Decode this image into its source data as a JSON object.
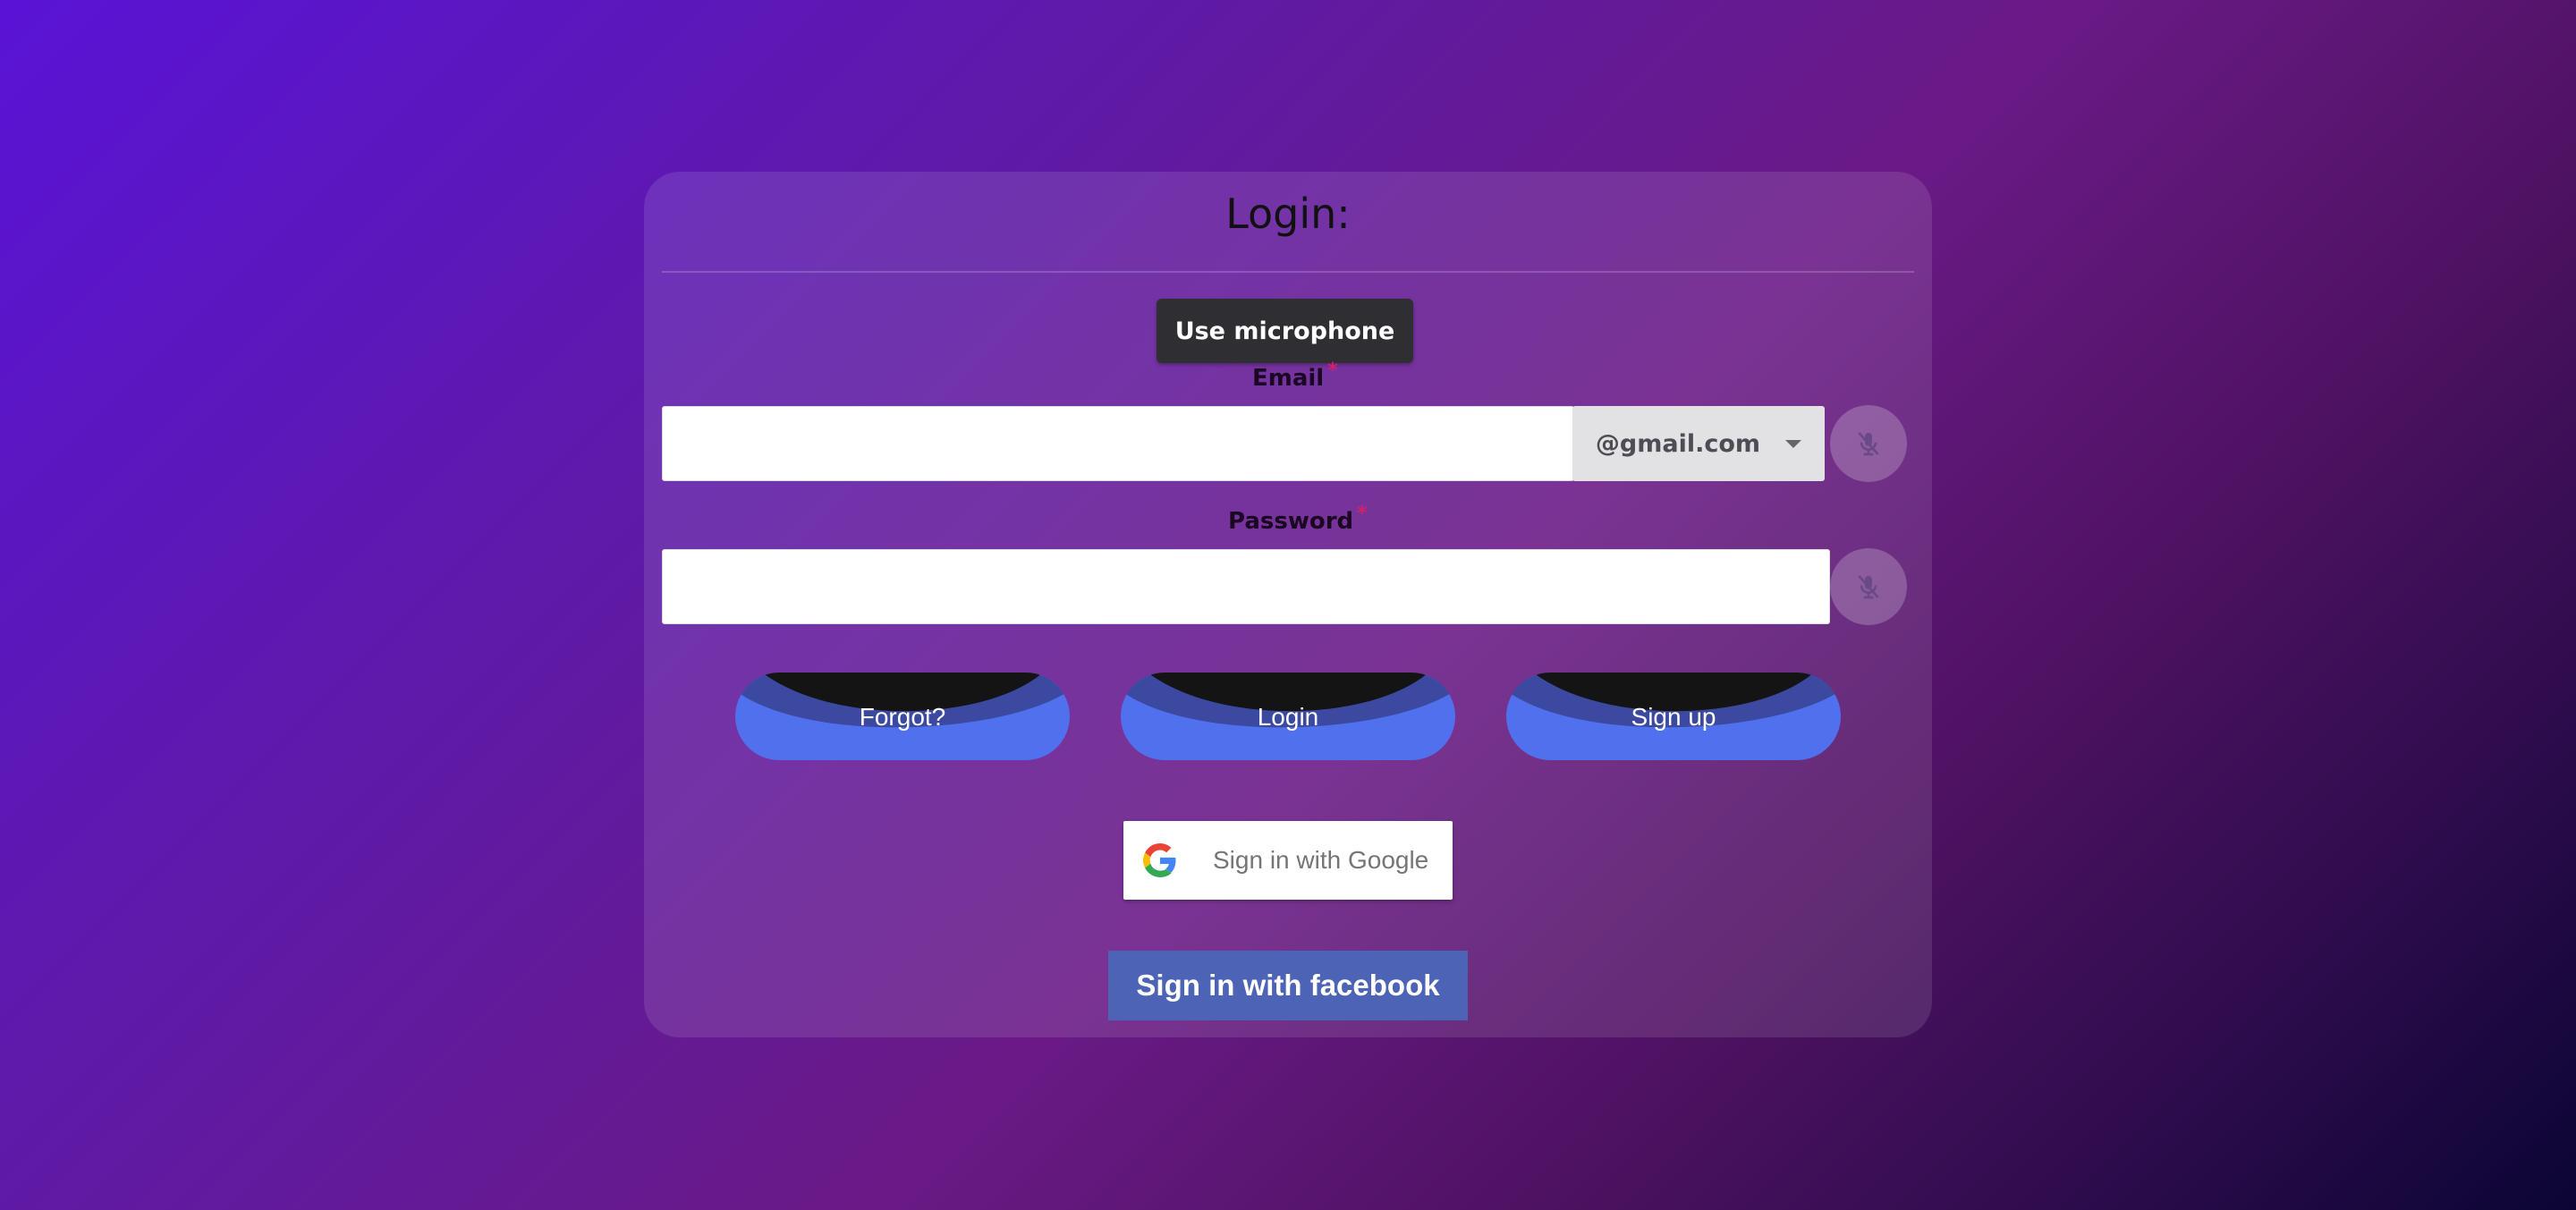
{
  "card": {
    "title": "Login:"
  },
  "microphone_button": {
    "label": "Use microphone"
  },
  "email": {
    "label": "Email",
    "required_mark": "*",
    "value": "",
    "domain_selected": "@gmail.com"
  },
  "password": {
    "label": "Password",
    "required_mark": "*",
    "value": ""
  },
  "actions": {
    "forgot": "Forgot?",
    "login": "Login",
    "signup": "Sign up"
  },
  "social": {
    "google": "Sign in with Google",
    "facebook": "Sign in with facebook"
  },
  "icons": {
    "mic_off": "microphone-off-icon",
    "google": "google-g-icon",
    "caret": "caret-down-icon"
  },
  "colors": {
    "pill_blue": "#5170ee",
    "pill_dark": "#141414",
    "facebook_blue": "#4c63b6",
    "mic_button_bg": "#2f2f33",
    "required_red": "#d0226b"
  }
}
